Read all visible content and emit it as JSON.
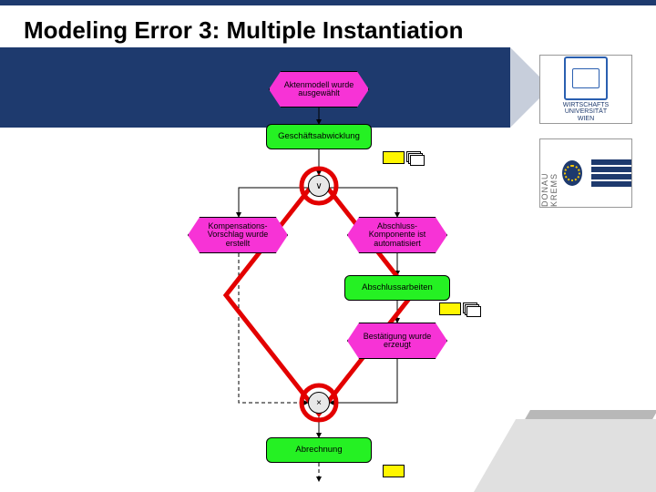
{
  "title": "Modeling Error 3: Multiple Instantiation",
  "logos": {
    "wu": {
      "line1": "WIRTSCHAFTS",
      "line2": "UNIVERSITÄT",
      "line3": "WIEN"
    },
    "donau": {
      "letters": "DONAU KREMS"
    }
  },
  "nodes": {
    "event_top": "Aktenmodell wurde ausgewählt",
    "func_top": "Geschäftsabwicklung",
    "gate1": "∨",
    "event_left": "Kompensations-Vorschlag wurde erstellt",
    "event_right": "Abschluss-Komponente ist automatisiert",
    "func_right": "Abschlussarbeiten",
    "event_right2": "Bestätigung wurde erzeugt",
    "gate2": "×",
    "func_bottom": "Abrechnung"
  },
  "colors": {
    "brand_navy": "#1e3a6e",
    "event_magenta": "#f733d6",
    "func_green": "#25f123",
    "org_yellow": "#fff600",
    "highlight_red": "#e30000"
  }
}
